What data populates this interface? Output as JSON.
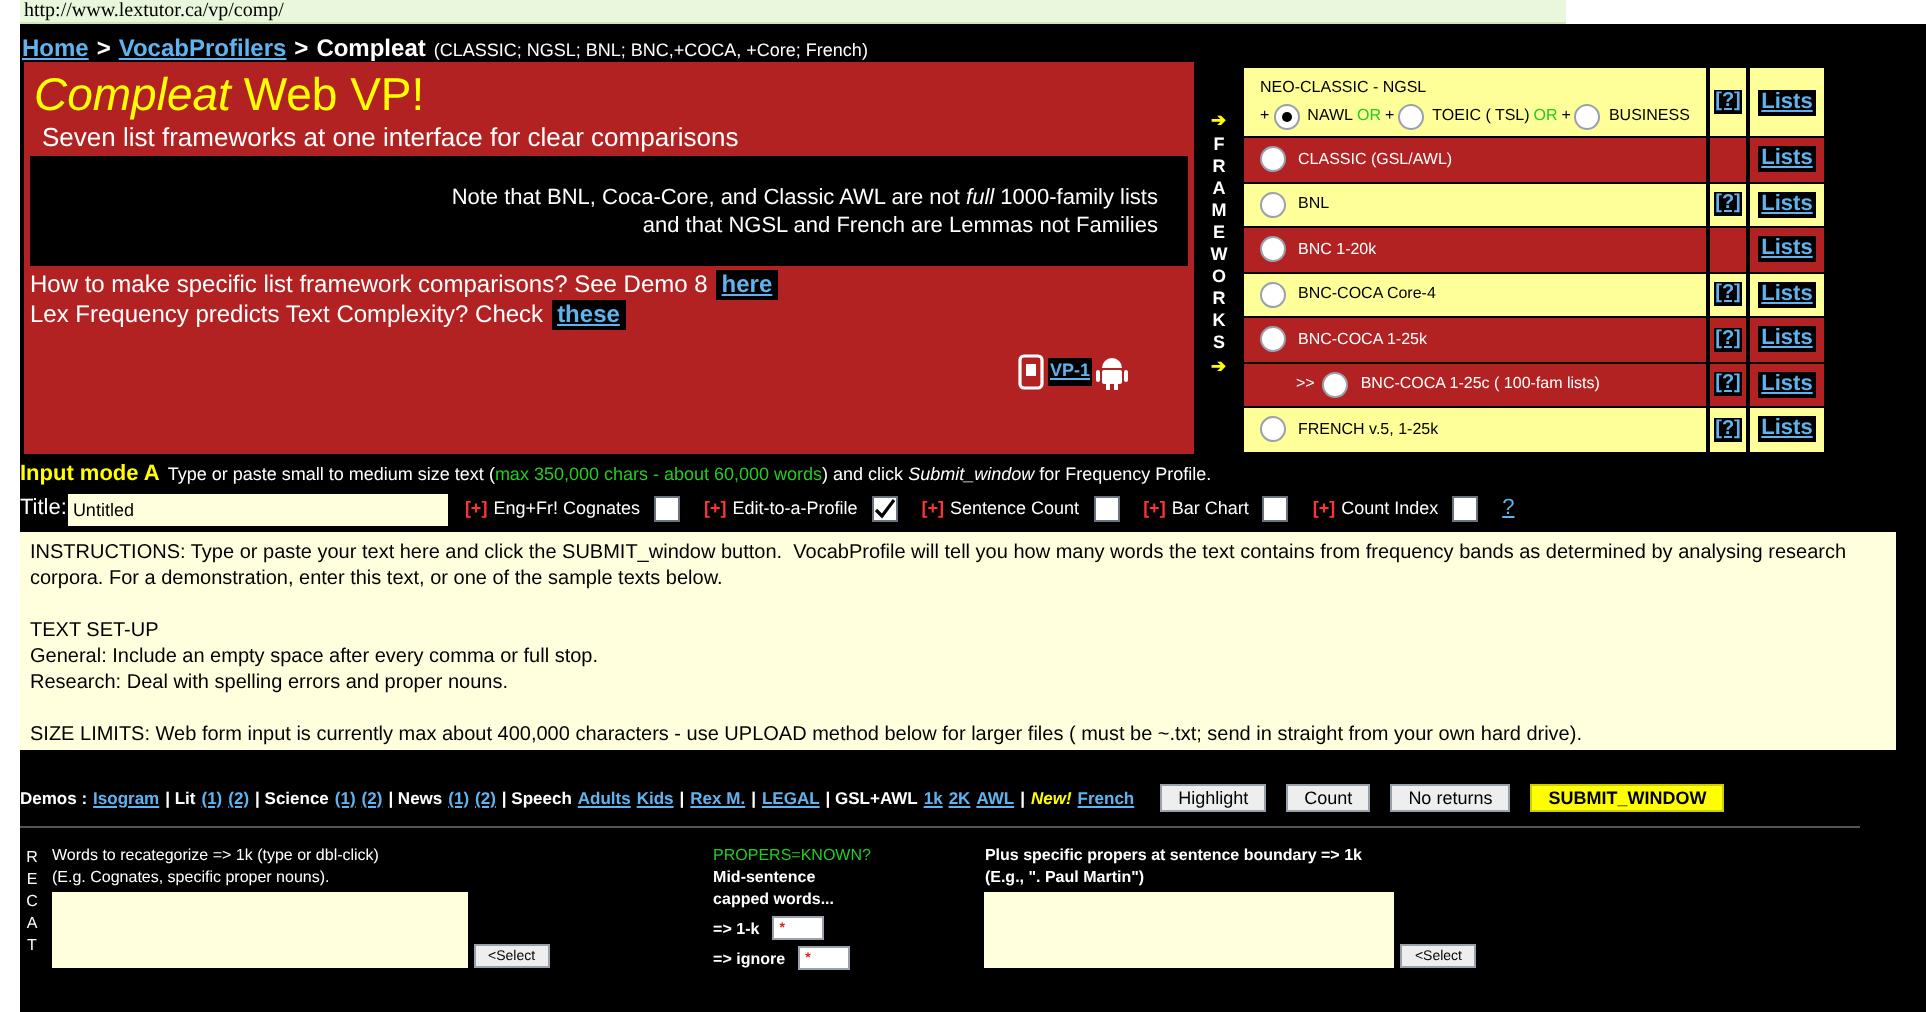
{
  "url": "http://www.lextutor.ca/vp/comp/",
  "breadcrumb": {
    "links": [
      "Home",
      "VocabProfilers"
    ],
    "separator": ">",
    "current": "Compleat",
    "note": "(CLASSIC; NGSL; BNL; BNC,+COCA, +Core; French)"
  },
  "banner": {
    "title": "*Compleat* Web VP!",
    "subtitle": "Seven list frameworks at one interface for clear comparisons",
    "note_lines": [
      "Note that BNL, Coca-Core, and Classic AWL are not *full* 1000-family lists",
      "and that NGSL and French are Lemmas not Families"
    ],
    "questions": [
      {
        "text": "How to make specific list framework comparisons? See Demo 8",
        "link": "here"
      },
      {
        "text": "Lex Frequency predicts Text Complexity? Check",
        "link": "these"
      }
    ],
    "app_link": "VP-1"
  },
  "frameworks": {
    "side_label": "FRAMEWORKS",
    "arrow": "➔",
    "rows": [
      {
        "kind": "group",
        "title": "NEO-CLASSIC  -  NGSL",
        "color": "#ffff99",
        "help": "[?]",
        "lists": "Lists",
        "parts": [
          {
            "kind": "plus",
            "text": "+"
          },
          {
            "kind": "radio",
            "label": "NAWL",
            "selected": true
          },
          {
            "kind": "or",
            "text": "OR"
          },
          {
            "kind": "plus",
            "text": "+"
          },
          {
            "kind": "radio",
            "label": "TOEIC ( TSL)",
            "selected": false
          },
          {
            "kind": "or",
            "text": "OR"
          },
          {
            "kind": "plus",
            "text": "+"
          },
          {
            "kind": "radio",
            "label": "BUSINESS",
            "selected": false
          }
        ]
      },
      {
        "kind": "radio",
        "label": "CLASSIC (GSL/AWL)",
        "selected": false,
        "color": "#b22222",
        "lists": "Lists"
      },
      {
        "kind": "radio",
        "label": "BNL",
        "selected": false,
        "color": "#ffff99",
        "help": "[?]",
        "lists": "Lists"
      },
      {
        "kind": "radio",
        "label": "BNC 1-20k",
        "selected": false,
        "color": "#b22222",
        "lists": "Lists"
      },
      {
        "kind": "radio",
        "label": "BNC-COCA Core-4",
        "selected": false,
        "color": "#ffff99",
        "help": "[?]",
        "lists": "Lists"
      },
      {
        "kind": "radio",
        "label": "BNC-COCA 1-25k",
        "selected": false,
        "color": "#b22222",
        "help": "[?]",
        "lists": "Lists"
      },
      {
        "kind": "radio",
        "prefix": ">>",
        "label": "BNC-COCA 1-25c ( 100-fam lists)",
        "selected": false,
        "color": "#b22222",
        "help": "[?]",
        "lists": "Lists"
      },
      {
        "kind": "radio",
        "label": "FRENCH v.5, 1-25k",
        "selected": false,
        "color": "#ffff99",
        "help": "[?]",
        "lists": "Lists"
      }
    ]
  },
  "input_mode": {
    "label": "Input mode A",
    "before": "Type or paste small to medium size text (",
    "highlight": "max 350,000 chars - about 60,000 words",
    "after": ") and click *Submit_window* for Frequency Profile."
  },
  "title_field": {
    "label": "Title:",
    "value": "Untitled"
  },
  "options": [
    {
      "mark": "[+]",
      "label": "Eng+Fr! Cognates",
      "checked": false
    },
    {
      "mark": "[+]",
      "label": "Edit-to-a-Profile",
      "checked": true
    },
    {
      "mark": "[+]",
      "label": "Sentence Count",
      "checked": false
    },
    {
      "mark": "[+]",
      "label": "Bar Chart",
      "checked": false
    },
    {
      "mark": "[+]",
      "label": "Count Index",
      "checked": false
    }
  ],
  "options_help": "?",
  "text_area": {
    "value": "INSTRUCTIONS: Type or paste your text here and click the SUBMIT_window button.  VocabProfile will tell you how many words the text contains from frequency bands as determined by analysing research corpora. For a demonstration, enter this text, or one of the sample texts below.\n\nTEXT SET-UP\nGeneral: Include an empty space after every comma or full stop.\nResearch: Deal with spelling errors and proper nouns.\n\nSIZE LIMITS: Web form input is currently max about 400,000 characters - use UPLOAD method below for larger files ( must be ~.txt; send in straight from your own hard drive)."
  },
  "demos": {
    "label": "Demos :",
    "parts": [
      {
        "kind": "link",
        "text": "Isogram"
      },
      {
        "kind": "text",
        "text": "| Lit"
      },
      {
        "kind": "link",
        "text": "(1)"
      },
      {
        "kind": "link",
        "text": "(2)"
      },
      {
        "kind": "text",
        "text": "| Science"
      },
      {
        "kind": "link",
        "text": "(1)"
      },
      {
        "kind": "link",
        "text": "(2)"
      },
      {
        "kind": "text",
        "text": "| News"
      },
      {
        "kind": "link",
        "text": "(1)"
      },
      {
        "kind": "link",
        "text": "(2)"
      },
      {
        "kind": "text",
        "text": "| Speech"
      },
      {
        "kind": "link",
        "text": "Adults"
      },
      {
        "kind": "link",
        "text": "Kids"
      },
      {
        "kind": "text",
        "text": "|"
      },
      {
        "kind": "link",
        "text": "Rex M."
      },
      {
        "kind": "text",
        "text": "|"
      },
      {
        "kind": "link",
        "text": "LEGAL"
      },
      {
        "kind": "text",
        "text": "| GSL+AWL"
      },
      {
        "kind": "link",
        "text": "1k"
      },
      {
        "kind": "link",
        "text": "2K"
      },
      {
        "kind": "link",
        "text": "AWL"
      },
      {
        "kind": "text",
        "text": "|"
      },
      {
        "kind": "new",
        "text": "New!"
      },
      {
        "kind": "link",
        "text": "French"
      }
    ],
    "buttons": [
      {
        "kind": "plain",
        "label": "Highlight"
      },
      {
        "kind": "plain",
        "label": "Count"
      },
      {
        "kind": "plain",
        "label": "No returns"
      },
      {
        "kind": "submit",
        "label": "SUBMIT_WINDOW"
      }
    ]
  },
  "recat": {
    "side_label": "RECAT",
    "lines": [
      "Words to recategorize => 1k (type or dbl-click)",
      "(E.g. Cognates, specific proper nouns)."
    ],
    "select": "<Select"
  },
  "propers": {
    "title": "PROPERS=KNOWN?",
    "lines": [
      "Mid-sentence",
      "capped words..."
    ],
    "choices": [
      {
        "label": "=> 1-k",
        "mark": "*"
      },
      {
        "label": "=> ignore",
        "mark": "*"
      }
    ]
  },
  "boundary": {
    "lines": [
      "Plus specific propers at sentence boundary => 1k",
      "(E.g., \". Paul Martin\")"
    ],
    "select": "<Select"
  }
}
